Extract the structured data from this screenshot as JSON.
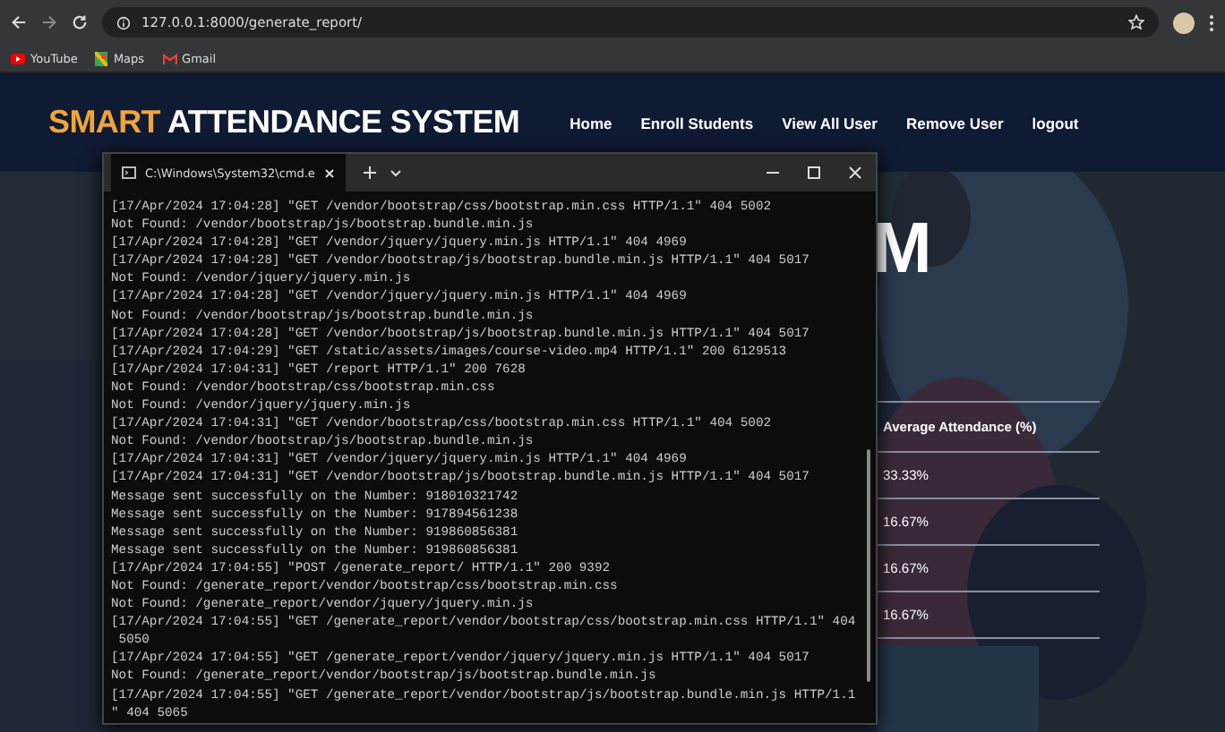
{
  "browser": {
    "url": "127.0.0.1:8000/generate_report/",
    "bookmarks": [
      "YouTube",
      "Maps",
      "Gmail"
    ]
  },
  "navbar": {
    "brand_accent": "SMART",
    "brand_rest": "ATTENDANCE SYSTEM",
    "links": [
      "Home",
      "Enroll Students",
      "View All User",
      "Remove User",
      "logout"
    ]
  },
  "hero": {
    "title": "M"
  },
  "table": {
    "columns": [
      "Average Attendance (%)"
    ],
    "rows": [
      [
        "33.33%"
      ],
      [
        "16.67%"
      ],
      [
        "16.67%"
      ],
      [
        "16.67%"
      ]
    ]
  },
  "terminal": {
    "tab_title": "C:\\Windows\\System32\\cmd.e",
    "lines": [
      "[17/Apr/2024 17:04:28] \"GET /vendor/bootstrap/css/bootstrap.min.css HTTP/1.1\" 404 5002",
      "Not Found: /vendor/bootstrap/js/bootstrap.bundle.min.js",
      "[17/Apr/2024 17:04:28] \"GET /vendor/jquery/jquery.min.js HTTP/1.1\" 404 4969",
      "[17/Apr/2024 17:04:28] \"GET /vendor/bootstrap/js/bootstrap.bundle.min.js HTTP/1.1\" 404 5017",
      "Not Found: /vendor/jquery/jquery.min.js",
      "[17/Apr/2024 17:04:28] \"GET /vendor/jquery/jquery.min.js HTTP/1.1\" 404 4969",
      "Not Found: /vendor/bootstrap/js/bootstrap.bundle.min.js",
      "[17/Apr/2024 17:04:28] \"GET /vendor/bootstrap/js/bootstrap.bundle.min.js HTTP/1.1\" 404 5017",
      "[17/Apr/2024 17:04:29] \"GET /static/assets/images/course-video.mp4 HTTP/1.1\" 200 6129513",
      "[17/Apr/2024 17:04:31] \"GET /report HTTP/1.1\" 200 7628",
      "Not Found: /vendor/bootstrap/css/bootstrap.min.css",
      "Not Found: /vendor/jquery/jquery.min.js",
      "[17/Apr/2024 17:04:31] \"GET /vendor/bootstrap/css/bootstrap.min.css HTTP/1.1\" 404 5002",
      "Not Found: /vendor/bootstrap/js/bootstrap.bundle.min.js",
      "[17/Apr/2024 17:04:31] \"GET /vendor/jquery/jquery.min.js HTTP/1.1\" 404 4969",
      "[17/Apr/2024 17:04:31] \"GET /vendor/bootstrap/js/bootstrap.bundle.min.js HTTP/1.1\" 404 5017",
      "Message sent successfully on the Number: 918010321742",
      "Message sent successfully on the Number: 917894561238",
      "Message sent successfully on the Number: 919860856381",
      "Message sent successfully on the Number: 919860856381",
      "[17/Apr/2024 17:04:55] \"POST /generate_report/ HTTP/1.1\" 200 9392",
      "Not Found: /generate_report/vendor/bootstrap/css/bootstrap.min.css",
      "Not Found: /generate_report/vendor/jquery/jquery.min.js",
      "[17/Apr/2024 17:04:55] \"GET /generate_report/vendor/bootstrap/css/bootstrap.min.css HTTP/1.1\" 404",
      " 5050",
      "[17/Apr/2024 17:04:55] \"GET /generate_report/vendor/jquery/jquery.min.js HTTP/1.1\" 404 5017",
      "Not Found: /generate_report/vendor/bootstrap/js/bootstrap.bundle.min.js",
      "[17/Apr/2024 17:04:55] \"GET /generate_report/vendor/bootstrap/js/bootstrap.bundle.min.js HTTP/1.1",
      "\" 404 5065"
    ]
  }
}
